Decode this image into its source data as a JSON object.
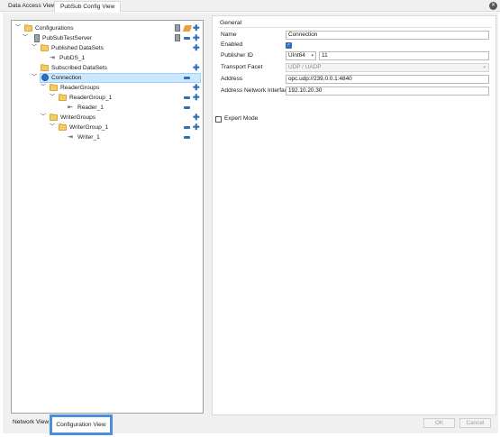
{
  "top_tabs": [
    "Data Access View",
    "PubSub Config View"
  ],
  "tree": {
    "rows": [
      {
        "label": "Configurations"
      },
      {
        "label": "PubSubTestServer"
      },
      {
        "label": "Published DataSets"
      },
      {
        "label": "PubDS_1"
      },
      {
        "label": "Subscribed DataSets"
      },
      {
        "label": "Connection"
      },
      {
        "label": "ReaderGroups"
      },
      {
        "label": "ReaderGroup_1"
      },
      {
        "label": "Reader_1"
      },
      {
        "label": "WriterGroups"
      },
      {
        "label": "WriterGroup_1"
      },
      {
        "label": "Writer_1"
      }
    ]
  },
  "bottom_tabs": [
    "Network View",
    "Configuration View"
  ],
  "general": {
    "title": "General",
    "name_label": "Name",
    "name_value": "Connection",
    "enabled_label": "Enabled",
    "enabled": true,
    "publisher_id_label": "Publisher ID",
    "publisher_id_type": "UInt64",
    "publisher_id_value": "11",
    "transport_label": "Transport Facet",
    "transport_value": "UDP / UADP",
    "address_label": "Address",
    "address_value": "opc.udp://239.0.0.1:4840",
    "ani_label": "Address Network Interface",
    "ani_value": "192.10.20.30"
  },
  "expert_mode_label": "Expert Mode",
  "buttons": {
    "ok": "OK",
    "cancel": "Cancel"
  },
  "colors": {
    "selection": "#cce8ff",
    "accent": "#4b8de0",
    "action_blue": "#2d6fb8"
  }
}
